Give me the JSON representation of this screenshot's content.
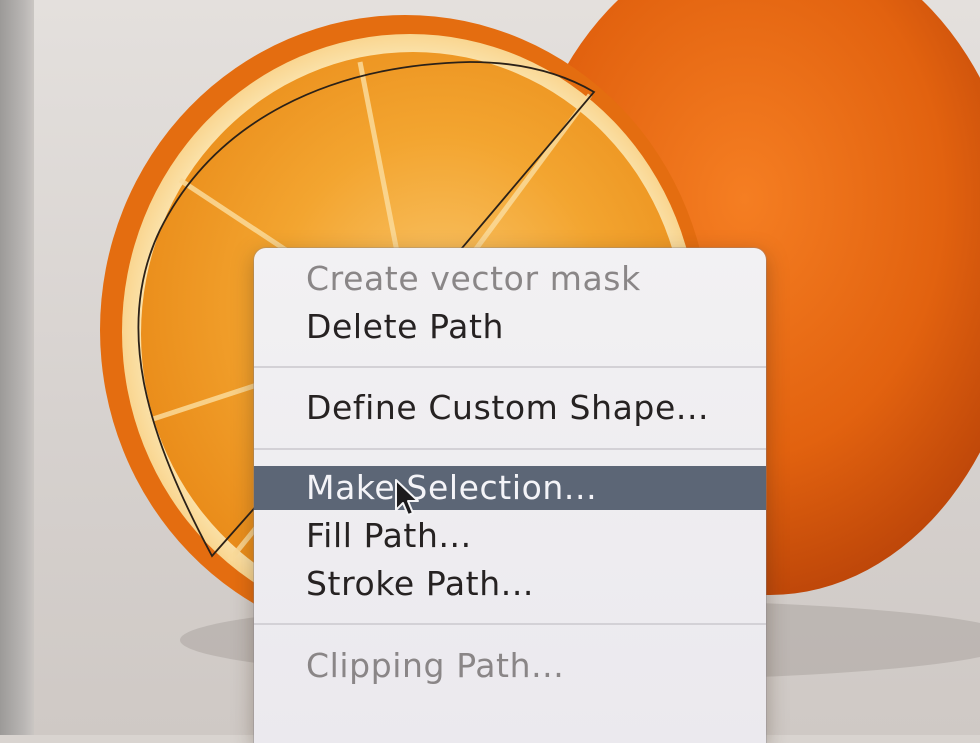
{
  "context_menu": {
    "items": [
      {
        "label": "Create vector mask",
        "state": "disabled"
      },
      {
        "label": "Delete Path",
        "state": "enabled"
      },
      {
        "label": "Define Custom Shape...",
        "state": "enabled"
      },
      {
        "label": "Make Selection...",
        "state": "highlighted"
      },
      {
        "label": "Fill Path...",
        "state": "enabled"
      },
      {
        "label": "Stroke Path...",
        "state": "enabled"
      },
      {
        "label": "Clipping Path...",
        "state": "disabled"
      }
    ]
  },
  "colors": {
    "menu_background": "#eeedf1",
    "highlight": "#5c6676",
    "orange_peel": "#e8660c",
    "orange_flesh": "#f2a12c"
  },
  "icons": {
    "cursor": "arrow-cursor-icon",
    "path": "vector-path-outline"
  }
}
